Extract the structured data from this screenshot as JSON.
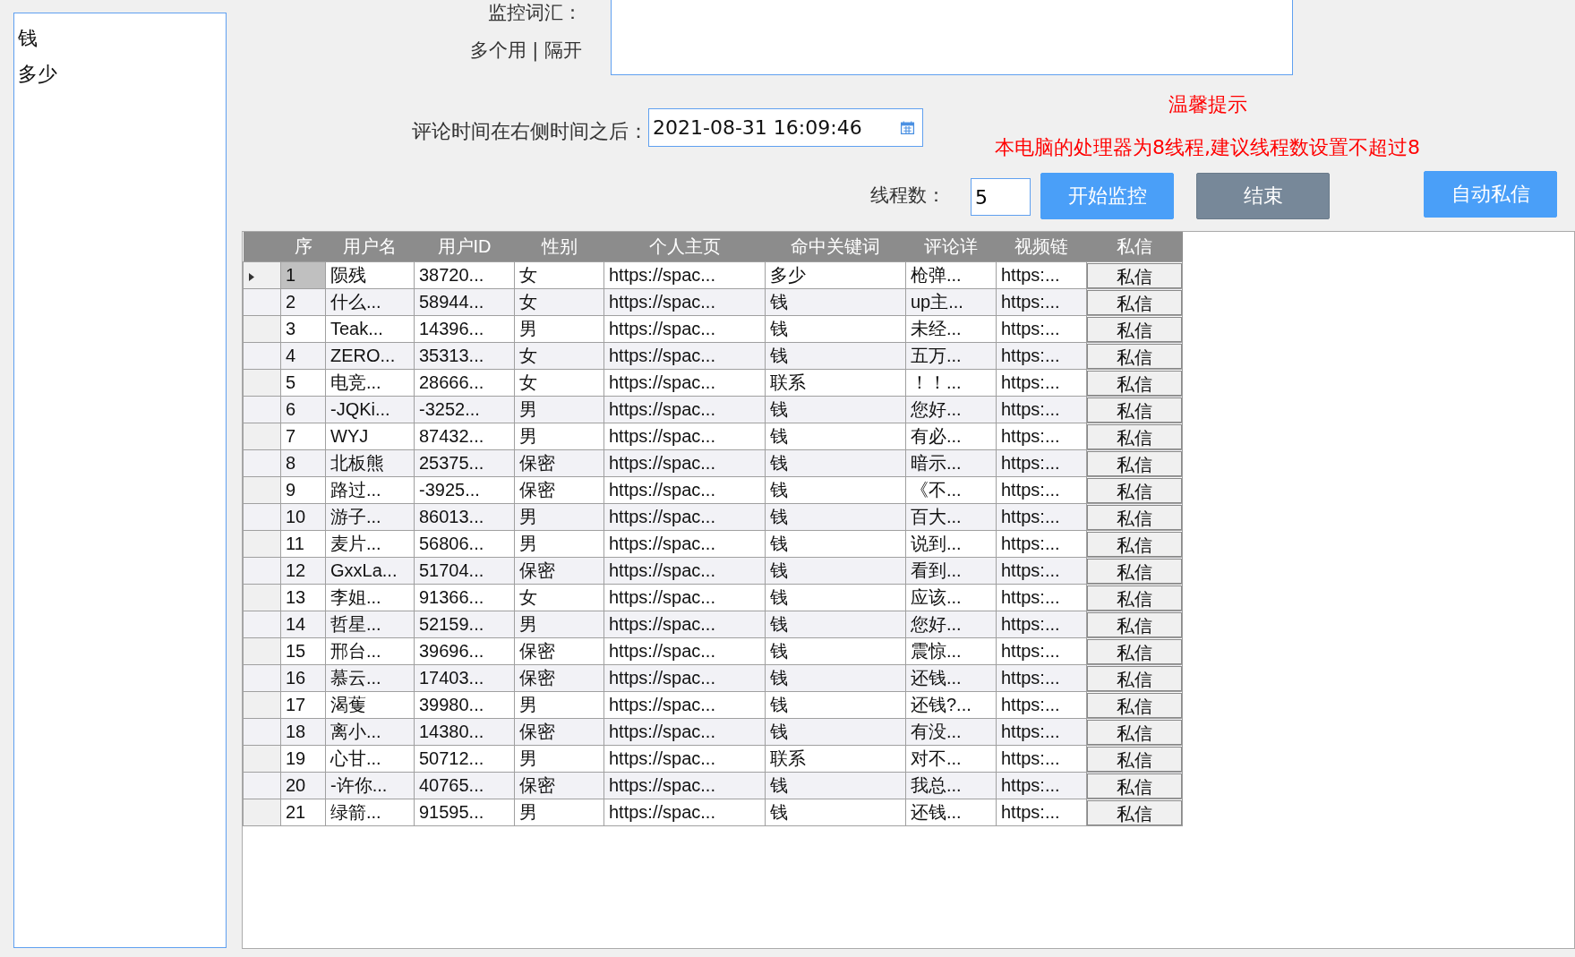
{
  "keywords_list": {
    "items": [
      "钱",
      "多少"
    ]
  },
  "monitor": {
    "label": "监控词汇：",
    "hint": "多个用 | 隔开"
  },
  "time_filter": {
    "label": "评论时间在右侧时间之后：",
    "value": "2021-08-31 16:09:46"
  },
  "tip": {
    "title": "温馨提示",
    "message": "本电脑的处理器为8线程,建议线程数设置不超过8"
  },
  "threads": {
    "label": "线程数：",
    "value": "5"
  },
  "buttons": [
    {
      "label": "开始监控",
      "kind": "primary"
    },
    {
      "label": "结束",
      "kind": "secondary"
    },
    {
      "label": "自动私信",
      "kind": "primary"
    }
  ],
  "table": {
    "columns": [
      "序",
      "用户名",
      "用户ID",
      "性别",
      "个人主页",
      "命中关键词",
      "评论详",
      "视频链",
      "私信"
    ],
    "rows": [
      {
        "selected": true,
        "cells": [
          "1",
          "陨残",
          "38720...",
          "女",
          "https://spac...",
          "多少",
          "枪弹...",
          "https:...",
          "私信"
        ]
      },
      {
        "selected": false,
        "cells": [
          "2",
          "什么...",
          "58944...",
          "女",
          "https://spac...",
          "钱",
          "up主...",
          "https:...",
          "私信"
        ]
      },
      {
        "selected": false,
        "cells": [
          "3",
          "Teak...",
          "14396...",
          "男",
          "https://spac...",
          "钱",
          "未经...",
          "https:...",
          "私信"
        ]
      },
      {
        "selected": false,
        "cells": [
          "4",
          "ZERO...",
          "35313...",
          "女",
          "https://spac...",
          "钱",
          "五万...",
          "https:...",
          "私信"
        ]
      },
      {
        "selected": false,
        "cells": [
          "5",
          "电竞...",
          "28666...",
          "女",
          "https://spac...",
          "联系",
          "！！...",
          "https:...",
          "私信"
        ]
      },
      {
        "selected": false,
        "cells": [
          "6",
          "-JQKi...",
          "-3252...",
          "男",
          "https://spac...",
          "钱",
          "您好...",
          "https:...",
          "私信"
        ]
      },
      {
        "selected": false,
        "cells": [
          "7",
          " WYJ",
          "87432...",
          "男",
          "https://spac...",
          "钱",
          "有必...",
          "https:...",
          "私信"
        ]
      },
      {
        "selected": false,
        "cells": [
          "8",
          "北板熊",
          "25375...",
          "保密",
          "https://spac...",
          "钱",
          "暗示...",
          "https:...",
          "私信"
        ]
      },
      {
        "selected": false,
        "cells": [
          "9",
          "路过...",
          "-3925...",
          "保密",
          "https://spac...",
          "钱",
          "《不...",
          "https:...",
          "私信"
        ]
      },
      {
        "selected": false,
        "cells": [
          "10",
          "游子...",
          "86013...",
          "男",
          "https://spac...",
          "钱",
          "百大...",
          "https:...",
          "私信"
        ]
      },
      {
        "selected": false,
        "cells": [
          "11",
          "麦片...",
          "56806...",
          "男",
          "https://spac...",
          "钱",
          "说到...",
          "https:...",
          "私信"
        ]
      },
      {
        "selected": false,
        "cells": [
          "12",
          "GxxLa...",
          "51704...",
          "保密",
          "https://spac...",
          "钱",
          "看到...",
          "https:...",
          "私信"
        ]
      },
      {
        "selected": false,
        "cells": [
          "13",
          "李姐...",
          "91366...",
          "女",
          "https://spac...",
          "钱",
          "应该...",
          "https:...",
          "私信"
        ]
      },
      {
        "selected": false,
        "cells": [
          "14",
          "哲星...",
          "52159...",
          "男",
          "https://spac...",
          "钱",
          "您好...",
          "https:...",
          "私信"
        ]
      },
      {
        "selected": false,
        "cells": [
          "15",
          "邢台...",
          "39696...",
          "保密",
          "https://spac...",
          "钱",
          "震惊...",
          "https:...",
          "私信"
        ]
      },
      {
        "selected": false,
        "cells": [
          "16",
          "慕云...",
          "17403...",
          "保密",
          "https://spac...",
          "钱",
          "还钱...",
          "https:...",
          "私信"
        ]
      },
      {
        "selected": false,
        "cells": [
          "17",
          "渴蒦",
          "39980...",
          "男",
          "https://spac...",
          "钱",
          "还钱?...",
          "https:...",
          "私信"
        ]
      },
      {
        "selected": false,
        "cells": [
          "18",
          "离小...",
          "14380...",
          "保密",
          "https://spac...",
          "钱",
          "有没...",
          "https:...",
          "私信"
        ]
      },
      {
        "selected": false,
        "cells": [
          "19",
          "心甘...",
          "50712...",
          "男",
          "https://spac...",
          "联系",
          "对不...",
          "https:...",
          "私信"
        ]
      },
      {
        "selected": false,
        "cells": [
          "20",
          "-许你...",
          "40765...",
          "保密",
          "https://spac...",
          "钱",
          "我总...",
          "https:...",
          "私信"
        ]
      },
      {
        "selected": false,
        "cells": [
          "21",
          "绿箭...",
          "91595...",
          "男",
          "https://spac...",
          "钱",
          "还钱...",
          "https:...",
          "私信"
        ]
      }
    ]
  }
}
